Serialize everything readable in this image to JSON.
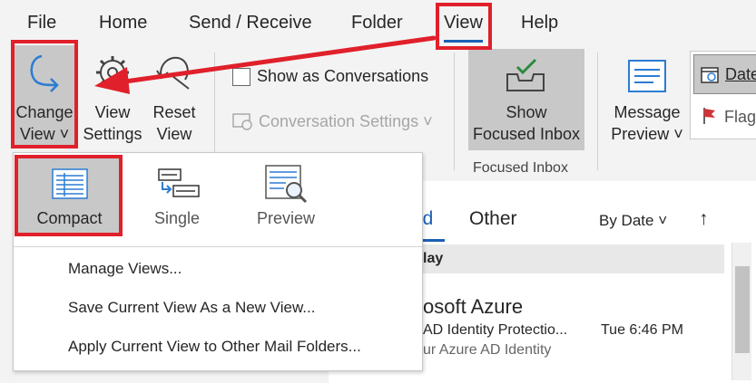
{
  "menu": {
    "file": "File",
    "home": "Home",
    "send_receive": "Send / Receive",
    "folder": "Folder",
    "view": "View",
    "help": "Help"
  },
  "ribbon": {
    "change_view_line1": "Change",
    "change_view_line2": "View ˅",
    "view_settings_line1": "View",
    "view_settings_line2": "Settings",
    "reset_view_line1": "Reset",
    "reset_view_line2": "View",
    "show_as_conversations": "Show as Conversations",
    "conversation_settings": "Conversation Settings ˅",
    "show_focused_line1": "Show",
    "show_focused_line2": "Focused Inbox",
    "focused_inbox_group": "Focused Inbox",
    "message_preview_line1": "Message",
    "message_preview_line2": "Preview ˅",
    "date_item": "Date",
    "flag_item": "Flag"
  },
  "dropdown": {
    "compact": "Compact",
    "single": "Single",
    "preview": "Preview",
    "manage_views": "Manage Views...",
    "save_current_view": "Save Current View As a New View...",
    "apply_current_view": "Apply Current View to Other Mail Folders..."
  },
  "mail": {
    "tab_focused_partial": "ed",
    "tab_other": "Other",
    "sort_label": "By Date ˅",
    "sort_arrow": "↑",
    "group_header_partial": "lay",
    "sender_partial": "osoft Azure",
    "subject_partial": "AD Identity Protectio...",
    "time": "Tue 6:46 PM",
    "preview_partial": "ur Azure AD Identity"
  },
  "colors": {
    "annotation_red": "#e0202a",
    "accent_blue": "#1a5fb4",
    "icon_blue": "#2b7cd3"
  }
}
